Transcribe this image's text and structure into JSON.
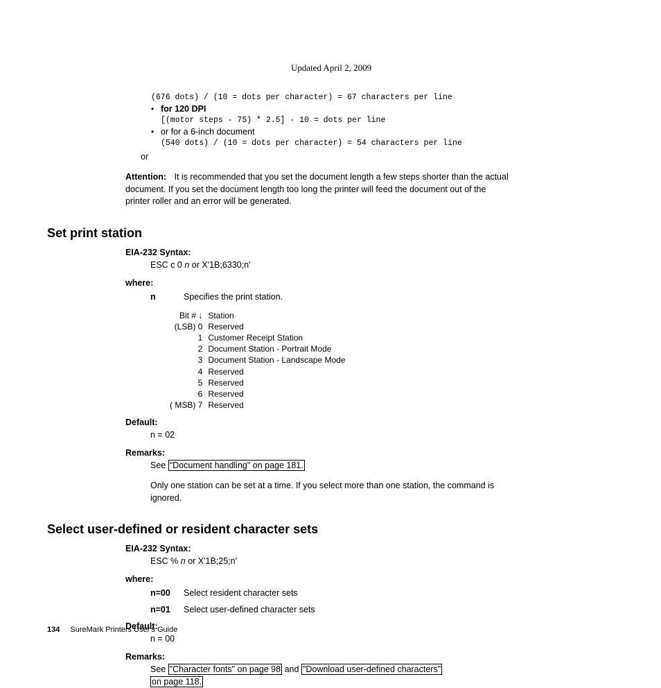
{
  "header": {
    "updated": "Updated April 2, 2009"
  },
  "top": {
    "code1": "(676 dots) / (10 = dots per character) = 67 characters per line",
    "bullet1": "for 120 DPI",
    "code2": "[(motor steps - 75) * 2.5] - 10 = dots per line",
    "bullet2": "or for a 6-inch document",
    "code3": "(540 dots) / (10 = dots per character) = 54 characters per line",
    "or": "or"
  },
  "attention": {
    "label": "Attention:",
    "text": "It is recommended that you set the document length a few steps shorter than the actual document. If you set the document length too long the printer will feed the document out of the printer roller and an error will be generated."
  },
  "section1": {
    "title": "Set print station",
    "syntax_label": "EIA-232 Syntax:",
    "syntax_pre": "ESC c 0 ",
    "syntax_n": "n",
    "syntax_post": " or X'1B;6330;n'",
    "where": "where:",
    "param_n": "n",
    "param_n_desc": "Specifies the print station.",
    "bit_header_l": "Bit # ↓",
    "bit_header_r": "Station",
    "bits": [
      {
        "l": "(LSB) 0",
        "r": "Reserved"
      },
      {
        "l": "1",
        "r": "Customer Receipt Station"
      },
      {
        "l": "2",
        "r": "Document Station - Portrait Mode"
      },
      {
        "l": "3",
        "r": "Document Station - Landscape Mode"
      },
      {
        "l": "4",
        "r": "Reserved"
      },
      {
        "l": "5",
        "r": "Reserved"
      },
      {
        "l": "6",
        "r": "Reserved"
      },
      {
        "l": "( MSB) 7",
        "r": "Reserved"
      }
    ],
    "default_label": "Default:",
    "default_val": "n = 02",
    "remarks_label": "Remarks:",
    "remarks_see": "See ",
    "remarks_link": "\"Document handling\" on page 181.",
    "remarks_body": "Only one station can be set at a time. If you select more than one station, the command is ignored."
  },
  "section2": {
    "title": "Select user-defined or resident character sets",
    "syntax_label": "EIA-232 Syntax:",
    "syntax_pre": "ESC % ",
    "syntax_n": "n",
    "syntax_post": " or X'1B;25;n'",
    "where": "where:",
    "p0_k": "n=00",
    "p0_v": "Select resident character sets",
    "p1_k": "n=01",
    "p1_v": "Select user-defined character sets",
    "default_label": "Default:",
    "default_val": "n = 00",
    "remarks_label": "Remarks:",
    "remarks_see": "See ",
    "remarks_link1": "\"Character fonts\" on page 98",
    "remarks_and": " and ",
    "remarks_link2": "\"Download user-defined characters\"",
    "remarks_link3": "on page 118."
  },
  "footer": {
    "page": "134",
    "title": "SureMark Printers User's Guide"
  }
}
